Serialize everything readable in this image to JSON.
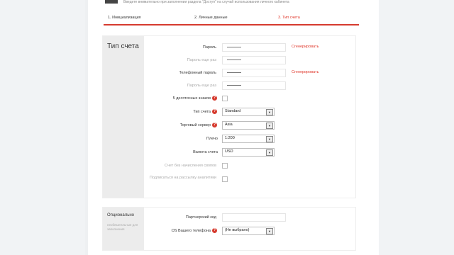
{
  "header": {
    "note": "Введите внимательно при заполнении раздела \"Доступ\" на случай использования личного кабинета"
  },
  "steps": [
    {
      "label": "1. Инициализация"
    },
    {
      "label": "2. Личные данные"
    },
    {
      "label": "3. Тип счета"
    }
  ],
  "account_panel": {
    "title": "Тип счета",
    "password_label": "Пароль",
    "password_repeat_label": "Пароль еще раз",
    "generate_link": "Сгенерировать",
    "phone_password_label": "Телефонный пароль",
    "phone_password_repeat_label": "Пароль еще раз",
    "phone_generate_link": "Сгенерировать",
    "decimals_label": "5 десятичных знаков",
    "account_type_label": "Тип счета",
    "account_type_value": "Standard",
    "server_label": "Торговый сервер",
    "server_value": "Asia",
    "leverage_label": "Плечо",
    "leverage_value": "1:200",
    "currency_label": "Валюта счета",
    "currency_value": "USD",
    "swap_free_label": "Счет без начисления свопов",
    "newsletter_label": "Подписаться на рассылку аналитики"
  },
  "optional_panel": {
    "title": "Опционально",
    "subtitle": "необязательные для заполнения",
    "partner_label": "Партнерский код",
    "phone_os_label": "OS Вашего телефона",
    "phone_os_value": "(Не выбрано)"
  },
  "colors": {
    "accent": "#d63b2f",
    "panel_side": "#ececec"
  }
}
